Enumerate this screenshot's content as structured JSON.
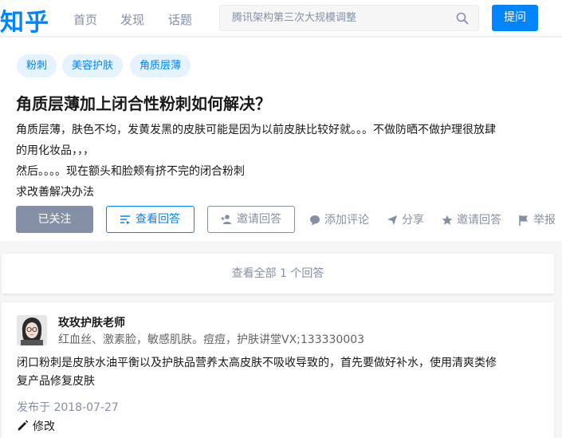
{
  "header": {
    "logo": "知乎",
    "nav": [
      "首页",
      "发现",
      "话题"
    ],
    "search_placeholder": "腾讯架构第三次大规模调整",
    "ask_label": "提问"
  },
  "question": {
    "tags": [
      "粉刺",
      "美容护肤",
      "角质层薄"
    ],
    "title": "角质层薄加上闭合性粉刺如何解决？",
    "detail_lines": [
      "角质层薄，肤色不均，发黄发黑的皮肤可能是因为以前皮肤比较好就。。。不做防晒不做护理很放肆",
      "的用化妆品，，，",
      "然后。。。。现在额头和脸颊有挤不完的闭合粉刺",
      "求改善解决办法"
    ],
    "buttons": {
      "follow": "已关注",
      "view_answers": "查看回答",
      "invite": "邀请回答"
    },
    "actions": {
      "comment": "添加评论",
      "share": "分享",
      "invite": "邀请回答",
      "report": "举报"
    }
  },
  "view_all": "查看全部 1 个回答",
  "answer": {
    "author_name": "玫玫护肤老师",
    "author_bio": "红血丝、激素脸，敏感肌肤。痘痘，护肤讲堂VX;133330003",
    "content_lines": [
      "闭口粉刺是皮肤水油平衡以及护肤品营养太高皮肤不吸收导致的，首先要做好补水，使用清爽类修",
      "复产品修复皮肤"
    ],
    "date": "发布于 2018-07-27",
    "edit_label": "修改"
  },
  "colors": {
    "brand": "#0084ff",
    "muted": "#8590a6",
    "tag_bg": "#e5f2ff"
  },
  "icons": [
    "search-icon",
    "view-answers-icon",
    "add-user-icon",
    "comment-icon",
    "share-icon",
    "star-icon",
    "flag-icon",
    "pencil-icon"
  ]
}
